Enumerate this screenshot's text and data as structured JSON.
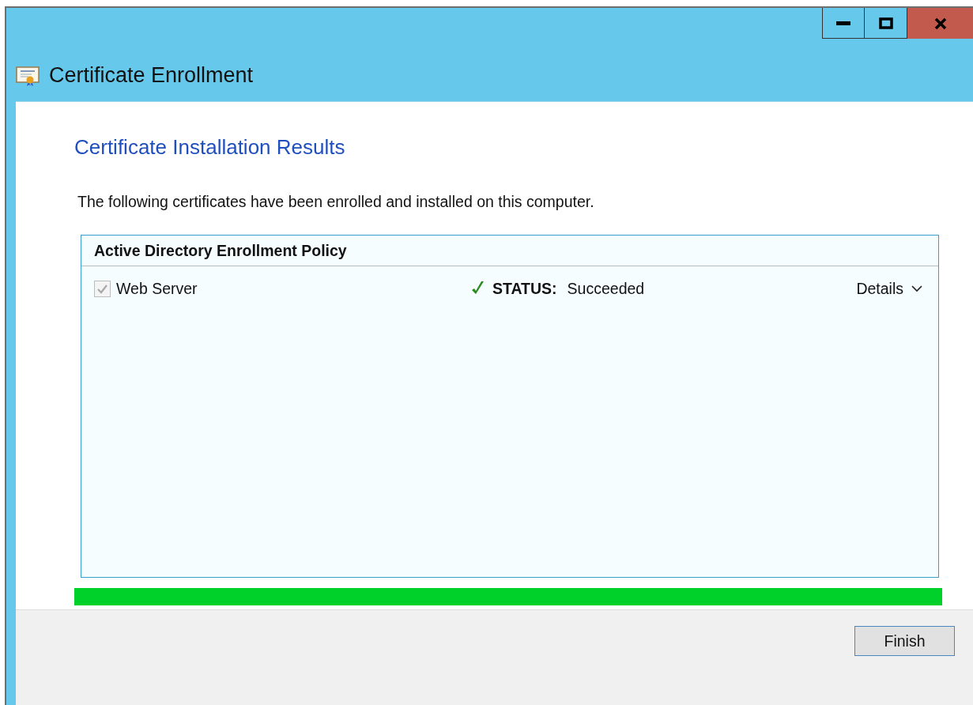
{
  "window": {
    "title": "Certificate Enrollment"
  },
  "page": {
    "heading": "Certificate Installation Results",
    "description": "The following certificates have been enrolled and installed on this computer."
  },
  "policy": {
    "name": "Active Directory Enrollment Policy",
    "certificates": [
      {
        "name": "Web Server",
        "checked": true,
        "disabled": true,
        "status_label": "STATUS:",
        "status": "Succeeded",
        "details": "Details",
        "expanded": false
      }
    ]
  },
  "buttons": [
    {
      "label": "Finish"
    }
  ]
}
